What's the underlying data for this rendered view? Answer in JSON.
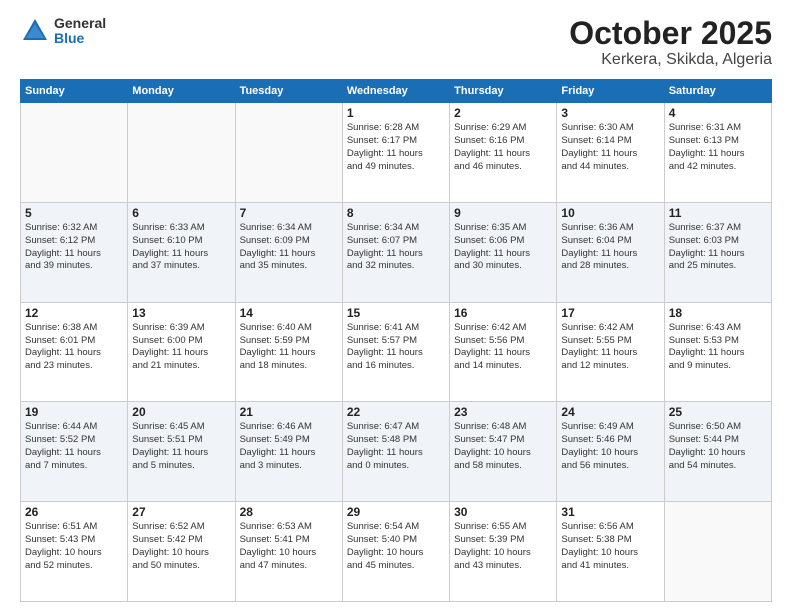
{
  "header": {
    "logo_general": "General",
    "logo_blue": "Blue",
    "title": "October 2025",
    "subtitle": "Kerkera, Skikda, Algeria"
  },
  "weekdays": [
    "Sunday",
    "Monday",
    "Tuesday",
    "Wednesday",
    "Thursday",
    "Friday",
    "Saturday"
  ],
  "weeks": [
    [
      {
        "day": "",
        "info": ""
      },
      {
        "day": "",
        "info": ""
      },
      {
        "day": "",
        "info": ""
      },
      {
        "day": "1",
        "info": "Sunrise: 6:28 AM\nSunset: 6:17 PM\nDaylight: 11 hours\nand 49 minutes."
      },
      {
        "day": "2",
        "info": "Sunrise: 6:29 AM\nSunset: 6:16 PM\nDaylight: 11 hours\nand 46 minutes."
      },
      {
        "day": "3",
        "info": "Sunrise: 6:30 AM\nSunset: 6:14 PM\nDaylight: 11 hours\nand 44 minutes."
      },
      {
        "day": "4",
        "info": "Sunrise: 6:31 AM\nSunset: 6:13 PM\nDaylight: 11 hours\nand 42 minutes."
      }
    ],
    [
      {
        "day": "5",
        "info": "Sunrise: 6:32 AM\nSunset: 6:12 PM\nDaylight: 11 hours\nand 39 minutes."
      },
      {
        "day": "6",
        "info": "Sunrise: 6:33 AM\nSunset: 6:10 PM\nDaylight: 11 hours\nand 37 minutes."
      },
      {
        "day": "7",
        "info": "Sunrise: 6:34 AM\nSunset: 6:09 PM\nDaylight: 11 hours\nand 35 minutes."
      },
      {
        "day": "8",
        "info": "Sunrise: 6:34 AM\nSunset: 6:07 PM\nDaylight: 11 hours\nand 32 minutes."
      },
      {
        "day": "9",
        "info": "Sunrise: 6:35 AM\nSunset: 6:06 PM\nDaylight: 11 hours\nand 30 minutes."
      },
      {
        "day": "10",
        "info": "Sunrise: 6:36 AM\nSunset: 6:04 PM\nDaylight: 11 hours\nand 28 minutes."
      },
      {
        "day": "11",
        "info": "Sunrise: 6:37 AM\nSunset: 6:03 PM\nDaylight: 11 hours\nand 25 minutes."
      }
    ],
    [
      {
        "day": "12",
        "info": "Sunrise: 6:38 AM\nSunset: 6:01 PM\nDaylight: 11 hours\nand 23 minutes."
      },
      {
        "day": "13",
        "info": "Sunrise: 6:39 AM\nSunset: 6:00 PM\nDaylight: 11 hours\nand 21 minutes."
      },
      {
        "day": "14",
        "info": "Sunrise: 6:40 AM\nSunset: 5:59 PM\nDaylight: 11 hours\nand 18 minutes."
      },
      {
        "day": "15",
        "info": "Sunrise: 6:41 AM\nSunset: 5:57 PM\nDaylight: 11 hours\nand 16 minutes."
      },
      {
        "day": "16",
        "info": "Sunrise: 6:42 AM\nSunset: 5:56 PM\nDaylight: 11 hours\nand 14 minutes."
      },
      {
        "day": "17",
        "info": "Sunrise: 6:42 AM\nSunset: 5:55 PM\nDaylight: 11 hours\nand 12 minutes."
      },
      {
        "day": "18",
        "info": "Sunrise: 6:43 AM\nSunset: 5:53 PM\nDaylight: 11 hours\nand 9 minutes."
      }
    ],
    [
      {
        "day": "19",
        "info": "Sunrise: 6:44 AM\nSunset: 5:52 PM\nDaylight: 11 hours\nand 7 minutes."
      },
      {
        "day": "20",
        "info": "Sunrise: 6:45 AM\nSunset: 5:51 PM\nDaylight: 11 hours\nand 5 minutes."
      },
      {
        "day": "21",
        "info": "Sunrise: 6:46 AM\nSunset: 5:49 PM\nDaylight: 11 hours\nand 3 minutes."
      },
      {
        "day": "22",
        "info": "Sunrise: 6:47 AM\nSunset: 5:48 PM\nDaylight: 11 hours\nand 0 minutes."
      },
      {
        "day": "23",
        "info": "Sunrise: 6:48 AM\nSunset: 5:47 PM\nDaylight: 10 hours\nand 58 minutes."
      },
      {
        "day": "24",
        "info": "Sunrise: 6:49 AM\nSunset: 5:46 PM\nDaylight: 10 hours\nand 56 minutes."
      },
      {
        "day": "25",
        "info": "Sunrise: 6:50 AM\nSunset: 5:44 PM\nDaylight: 10 hours\nand 54 minutes."
      }
    ],
    [
      {
        "day": "26",
        "info": "Sunrise: 6:51 AM\nSunset: 5:43 PM\nDaylight: 10 hours\nand 52 minutes."
      },
      {
        "day": "27",
        "info": "Sunrise: 6:52 AM\nSunset: 5:42 PM\nDaylight: 10 hours\nand 50 minutes."
      },
      {
        "day": "28",
        "info": "Sunrise: 6:53 AM\nSunset: 5:41 PM\nDaylight: 10 hours\nand 47 minutes."
      },
      {
        "day": "29",
        "info": "Sunrise: 6:54 AM\nSunset: 5:40 PM\nDaylight: 10 hours\nand 45 minutes."
      },
      {
        "day": "30",
        "info": "Sunrise: 6:55 AM\nSunset: 5:39 PM\nDaylight: 10 hours\nand 43 minutes."
      },
      {
        "day": "31",
        "info": "Sunrise: 6:56 AM\nSunset: 5:38 PM\nDaylight: 10 hours\nand 41 minutes."
      },
      {
        "day": "",
        "info": ""
      }
    ]
  ]
}
